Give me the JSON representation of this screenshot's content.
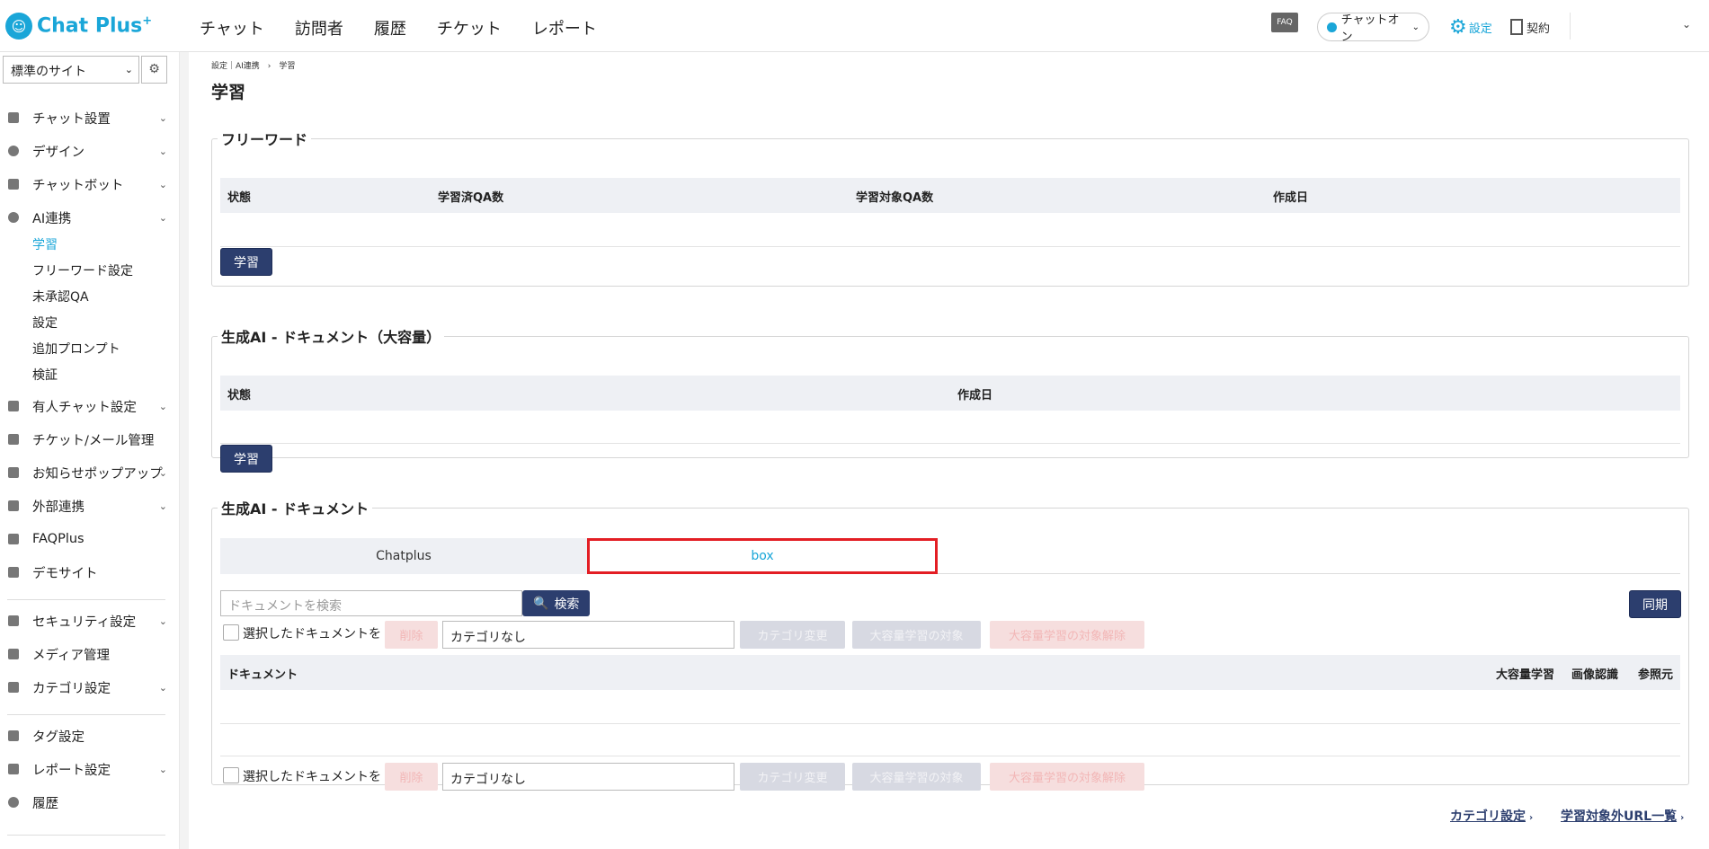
{
  "header": {
    "logo_text": "Chat Plus",
    "logo_sup": "+",
    "nav": [
      "チャット",
      "訪問者",
      "履歴",
      "チケット",
      "レポート"
    ],
    "faq_label": "FAQ",
    "chat_status": "チャットオン",
    "settings_label": "設定",
    "contract_label": "契約"
  },
  "sidebar": {
    "site_select": "標準のサイト",
    "items": [
      {
        "label": "チャット設置"
      },
      {
        "label": "デザイン"
      },
      {
        "label": "チャットボット"
      },
      {
        "label": "AI連携"
      },
      {
        "label": "有人チャット設定"
      },
      {
        "label": "チケット/メール管理"
      },
      {
        "label": "お知らせポップアップ"
      },
      {
        "label": "外部連携"
      },
      {
        "label": "FAQPlus"
      },
      {
        "label": "デモサイト"
      },
      {
        "label": "セキュリティ設定"
      },
      {
        "label": "メディア管理"
      },
      {
        "label": "カテゴリ設定"
      },
      {
        "label": "タグ設定"
      },
      {
        "label": "レポート設定"
      },
      {
        "label": "履歴"
      }
    ],
    "ai_sub": [
      "学習",
      "フリーワード設定",
      "未承認QA",
      "設定",
      "追加プロンプト",
      "検証"
    ]
  },
  "main": {
    "breadcrumb": "設定｜AI連携　›　学習",
    "title": "学習",
    "freeword": {
      "legend": "フリーワード",
      "cols": [
        "状態",
        "学習済QA数",
        "学習対象QA数",
        "作成日"
      ],
      "learn_button": "学習"
    },
    "genai_large": {
      "legend": "生成AI - ドキュメント（大容量）",
      "cols": [
        "状態",
        "作成日"
      ],
      "learn_button": "学習"
    },
    "genai_doc": {
      "legend": "生成AI - ドキュメント",
      "tabs": [
        "Chatplus",
        "box"
      ],
      "search_placeholder": "ドキュメントを検索",
      "search_button": "検索",
      "sync_button": "同期",
      "selected_label": "選択したドキュメントを",
      "delete_button": "削除",
      "category_value": "カテゴリなし",
      "category_change_button": "カテゴリ変更",
      "large_target_button": "大容量学習の対象",
      "large_untarget_button": "大容量学習の対象解除",
      "cols": [
        "ドキュメント",
        "大容量学習",
        "画像認識",
        "参照元"
      ]
    },
    "footer_links": [
      "カテゴリ設定",
      "学習対象外URL一覧"
    ]
  },
  "colors": {
    "accent": "#1aa6d8",
    "navy": "#2c3e6e",
    "highlight": "#e31e24"
  }
}
